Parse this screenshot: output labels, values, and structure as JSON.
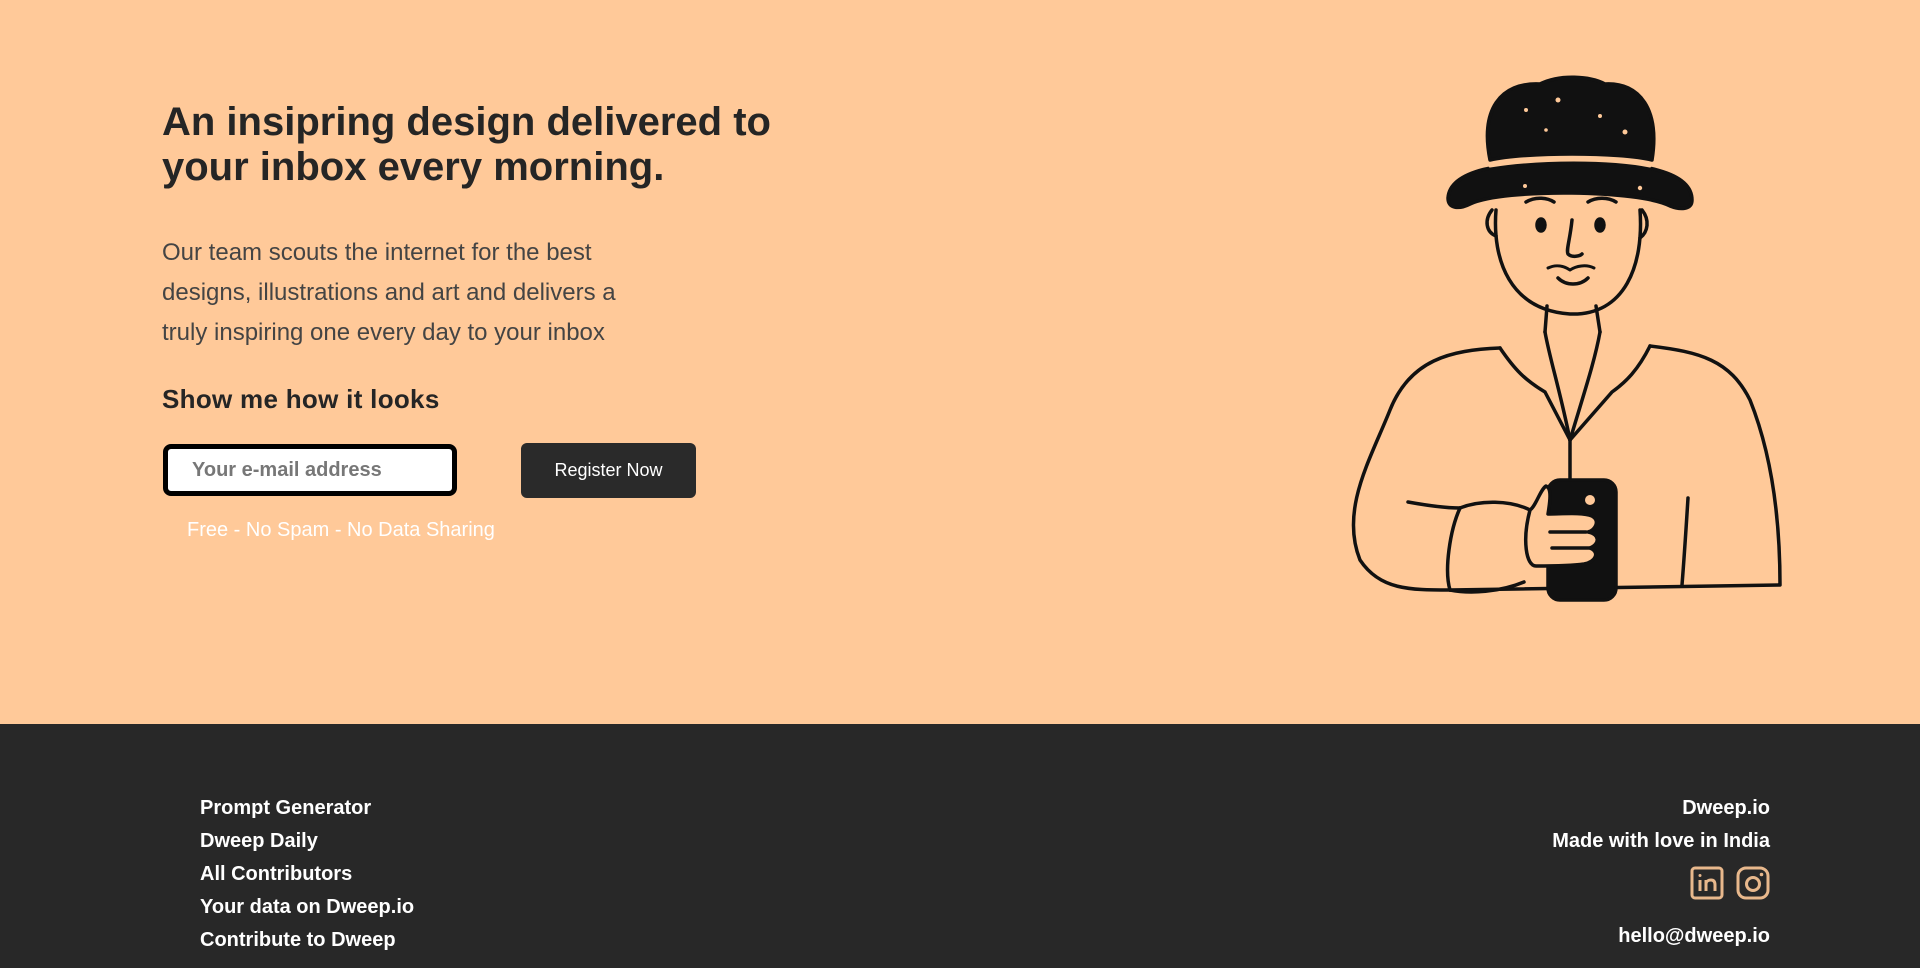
{
  "hero": {
    "headline": "An insipring design delivered to your inbox every morning.",
    "subcopy": "Our team scouts the internet for the best designs, illustrations and art and delivers a truly inspiring one every day to your inbox",
    "cta_heading": "Show me how it looks",
    "email_placeholder": "Your e-mail address",
    "register_label": "Register Now",
    "disclaimer": "Free - No Spam - No Data Sharing",
    "illustration": "man-with-hat-holding-phone"
  },
  "footer": {
    "links": [
      "Prompt Generator",
      "Dweep Daily",
      "All Contributors",
      "Your data on Dweep.io",
      "Contribute to Dweep"
    ],
    "brand": "Dweep.io",
    "tagline": "Made with love in India",
    "socials": [
      "linkedin-icon",
      "instagram-icon"
    ],
    "email": "hello@dweep.io"
  },
  "colors": {
    "hero_bg": "#ffc999",
    "footer_bg": "#282828",
    "button_bg": "#2a2a2a",
    "icon_accent": "#e8b88c"
  }
}
